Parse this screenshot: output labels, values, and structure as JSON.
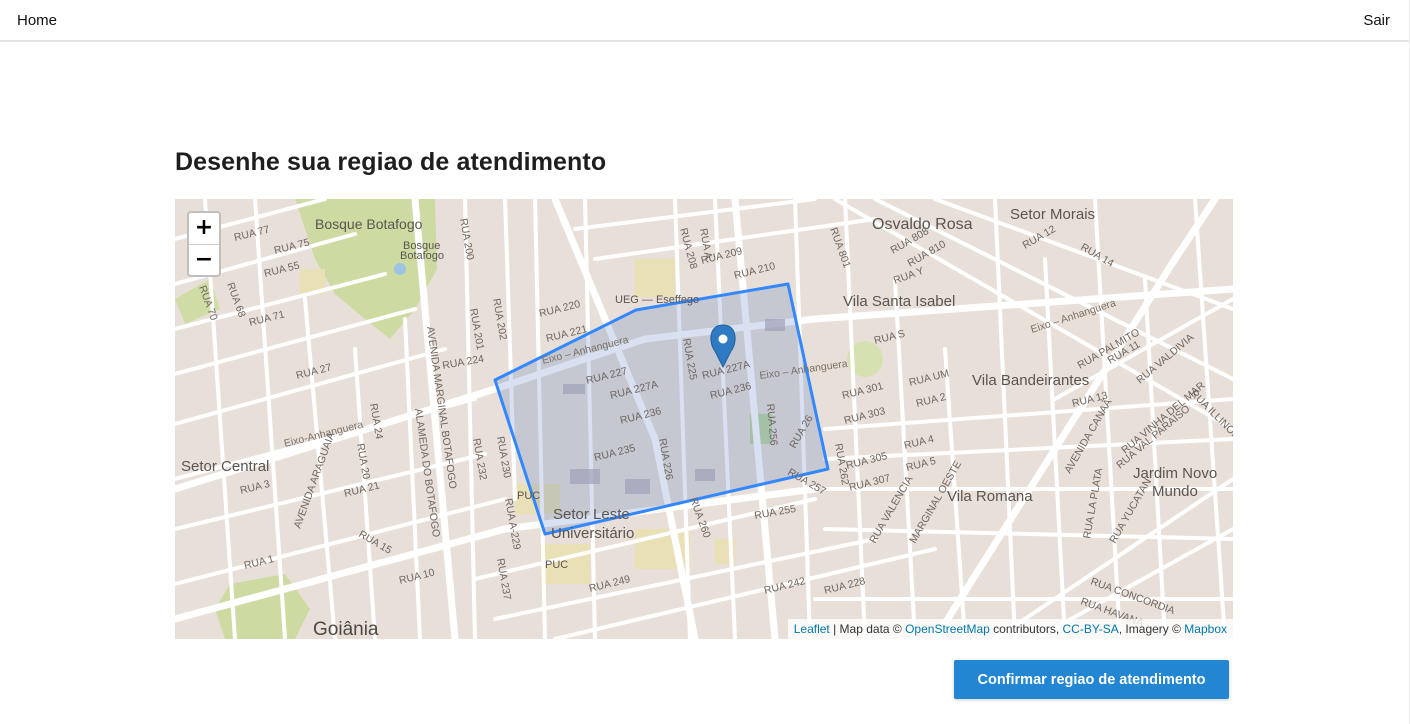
{
  "header": {
    "home_label": "Home",
    "logout_label": "Sair"
  },
  "page": {
    "title": "Desenhe sua regiao de atendimento"
  },
  "map": {
    "zoom_in": "+",
    "zoom_out": "−",
    "attribution": {
      "leaflet": "Leaflet",
      "map_data": " | Map data © ",
      "osm": "OpenStreetMap",
      "contributors": " contributors, ",
      "license": "CC-BY-SA",
      "imagery": ", Imagery © ",
      "mapbox": "Mapbox"
    },
    "places": {
      "bosque_botafogo": "Bosque Botafogo",
      "bosque": "Bosque",
      "botafogo": "Botafogo",
      "osvaldo_rosa": "Osvaldo Rosa",
      "setor_morais": "Setor Morais",
      "vila_santa_isabel": "Vila Santa Isabel",
      "vila_bandeirantes": "Vila Bandeirantes",
      "setor_central": "Setor Central",
      "vila_romana": "Vila Romana",
      "jardim_novo": "Jardim Novo",
      "mundo": "Mundo",
      "setor_leste": "Setor Leste",
      "universitario": "Universitário",
      "goiania": "Goiânia",
      "ueg": "UEG — Eseffego",
      "puc1": "PUC",
      "puc2": "PUC"
    },
    "streets": {
      "r220": "RUA 220",
      "r221": "RUA 221",
      "r224": "RUA 224",
      "r227": "RUA 227",
      "r227a": "RUA 227A",
      "r227a2": "RUA 227A",
      "r236": "RUA 236",
      "r236b": "RUA 236",
      "r235": "RUA 235",
      "r225": "RUA 225",
      "r226": "RUA 226",
      "r256": "RUA 256",
      "r257": "RUA 257",
      "r255": "RUA 255",
      "r260": "RUA 260",
      "r262": "RUA 262",
      "r261": "RUA 26",
      "r249": "RUA 249",
      "r242": "RUA 242",
      "r228": "RUA 228",
      "r301": "RUA 301",
      "r303": "RUA 303",
      "r305": "RUA 305",
      "r307": "RUA 307",
      "rum": "RUA UM",
      "r2": "RUA 2",
      "r4": "RUA 4",
      "r5": "RUA 5",
      "r13": "RUA 13",
      "r11": "RUA 11",
      "r12": "RUA 12",
      "r14": "RUA 14",
      "rs": "RUA S",
      "ry": "RUA Y",
      "r808": "RUA 808",
      "r810": "RUA 810",
      "r801": "RUA 801",
      "r209": "RUA 209",
      "r210": "RUA 210",
      "r208": "RUA 208",
      "r77": "RUA 77",
      "r75": "RUA 75",
      "r55": "RUA 55",
      "r71": "RUA 71",
      "r68": "RUA 68",
      "r70": "RUA 70",
      "r27": "RUA 27",
      "r24": "RUA 24",
      "r21": "RUA 21",
      "r20": "RUA 20",
      "r3": "RUA 3",
      "r1": "RUA 1",
      "r10": "RUA 10",
      "r15": "RUA 15",
      "r200": "RUA 200",
      "r201": "RUA 201",
      "r202": "RUA 202",
      "r230": "RUA 230",
      "r232": "RUA 232",
      "r237": "RUA 237",
      "r229": "RUA A-229",
      "ra": "RUA A",
      "eixo1": "Eixo – Anhanguera",
      "eixo2": "Eixo – Anhanguera",
      "eixo3": "Eixo-Anhanguera",
      "eixo4": "Eixo – Anhanguera",
      "av_marginal": "AVENIDA MARGINAL BOTAFOGO",
      "al_botafogo": "ALAMEDA DO BOTAFOGO",
      "av_araguaia": "AVENIDA ARAGUAIA",
      "av_canaa": "AVENIDA CANAÃ",
      "marginal_oeste": "MARGINAL OESTE",
      "r_palmito": "RUA PALMITO",
      "r_valdivia": "RUA VALDIVIA",
      "r_vinha": "RUA VINHA DEL MAR",
      "r_illinois": "RUA ILLINOIS",
      "r_valparaiso": "RUA VAL PARAISO",
      "r_yucatan": "RUA YUCATAN",
      "r_plata": "RUA LA PLATA",
      "r_concordia": "RUA CONCORDIA",
      "r_havana": "RUA HAVANA",
      "r_valencia": "RUA VALENCIA"
    }
  },
  "actions": {
    "confirm_label": "Confirmar regiao de atendimento"
  }
}
